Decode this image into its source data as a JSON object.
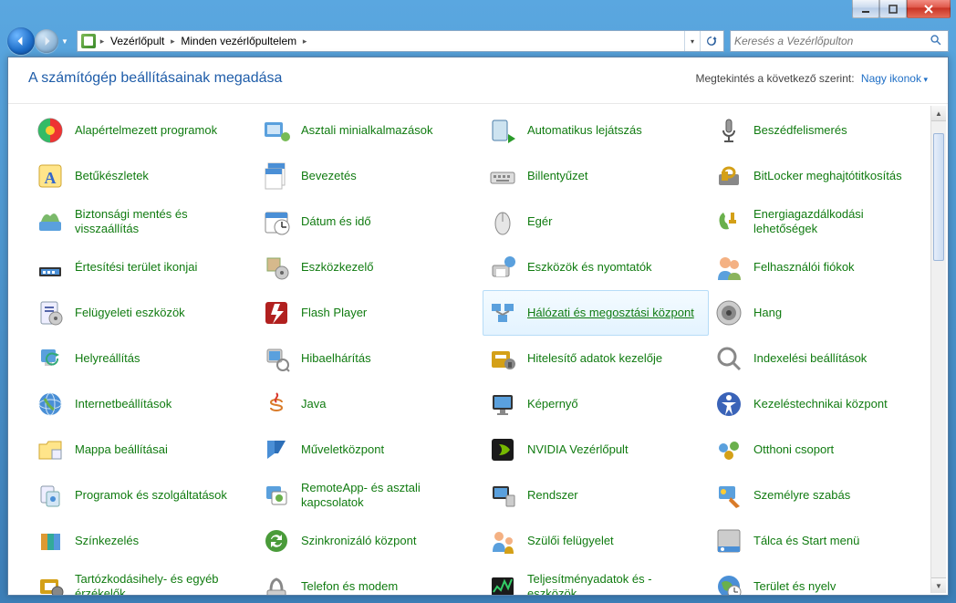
{
  "breadcrumb": {
    "part1": "Vezérlőpult",
    "part2": "Minden vezérlőpultelem"
  },
  "search": {
    "placeholder": "Keresés a Vezérlőpulton"
  },
  "header": {
    "title": "A számítógép beállításainak megadása",
    "view_label": "Megtekintés a következő szerint:",
    "view_value": "Nagy ikonok"
  },
  "items": [
    {
      "label": "Alapértelmezett programok",
      "icon": "default-programs"
    },
    {
      "label": "Asztali minialkalmazások",
      "icon": "gadgets"
    },
    {
      "label": "Automatikus lejátszás",
      "icon": "autoplay"
    },
    {
      "label": "Beszédfelismerés",
      "icon": "speech"
    },
    {
      "label": "Betűkészletek",
      "icon": "fonts"
    },
    {
      "label": "Bevezetés",
      "icon": "getting-started"
    },
    {
      "label": "Billentyűzet",
      "icon": "keyboard"
    },
    {
      "label": "BitLocker meghajtótitkosítás",
      "icon": "bitlocker"
    },
    {
      "label": "Biztonsági mentés és visszaállítás",
      "icon": "backup"
    },
    {
      "label": "Dátum és idő",
      "icon": "datetime"
    },
    {
      "label": "Egér",
      "icon": "mouse"
    },
    {
      "label": "Energiagazdálkodási lehetőségek",
      "icon": "power"
    },
    {
      "label": "Értesítési terület ikonjai",
      "icon": "notification"
    },
    {
      "label": "Eszközkezelő",
      "icon": "device-manager"
    },
    {
      "label": "Eszközök és nyomtatók",
      "icon": "devices-printers"
    },
    {
      "label": "Felhasználói fiókok",
      "icon": "users"
    },
    {
      "label": "Felügyeleti eszközök",
      "icon": "admin-tools"
    },
    {
      "label": "Flash Player",
      "icon": "flash"
    },
    {
      "label": "Hálózati és megosztási központ",
      "icon": "network",
      "selected": true
    },
    {
      "label": "Hang",
      "icon": "sound"
    },
    {
      "label": "Helyreállítás",
      "icon": "recovery"
    },
    {
      "label": "Hibaelhárítás",
      "icon": "troubleshoot"
    },
    {
      "label": "Hitelesítő adatok kezelője",
      "icon": "credentials"
    },
    {
      "label": "Indexelési beállítások",
      "icon": "indexing"
    },
    {
      "label": "Internetbeállítások",
      "icon": "internet"
    },
    {
      "label": "Java",
      "icon": "java"
    },
    {
      "label": "Képernyő",
      "icon": "display"
    },
    {
      "label": "Kezeléstechnikai központ",
      "icon": "ease-of-access"
    },
    {
      "label": "Mappa beállításai",
      "icon": "folder-options"
    },
    {
      "label": "Műveletközpont",
      "icon": "action-center"
    },
    {
      "label": "NVIDIA Vezérlőpult",
      "icon": "nvidia"
    },
    {
      "label": "Otthoni csoport",
      "icon": "homegroup"
    },
    {
      "label": "Programok és szolgáltatások",
      "icon": "programs"
    },
    {
      "label": "RemoteApp- és asztali kapcsolatok",
      "icon": "remoteapp"
    },
    {
      "label": "Rendszer",
      "icon": "system"
    },
    {
      "label": "Személyre szabás",
      "icon": "personalize"
    },
    {
      "label": "Színkezelés",
      "icon": "color"
    },
    {
      "label": "Szinkronizáló központ",
      "icon": "sync"
    },
    {
      "label": "Szülői felügyelet",
      "icon": "parental"
    },
    {
      "label": "Tálca és Start menü",
      "icon": "taskbar"
    },
    {
      "label": "Tartózkodásihely- és egyéb érzékelők",
      "icon": "location"
    },
    {
      "label": "Telefon és modem",
      "icon": "phone"
    },
    {
      "label": "Teljesítményadatok és -eszközök",
      "icon": "performance"
    },
    {
      "label": "Terület és nyelv",
      "icon": "region"
    }
  ]
}
